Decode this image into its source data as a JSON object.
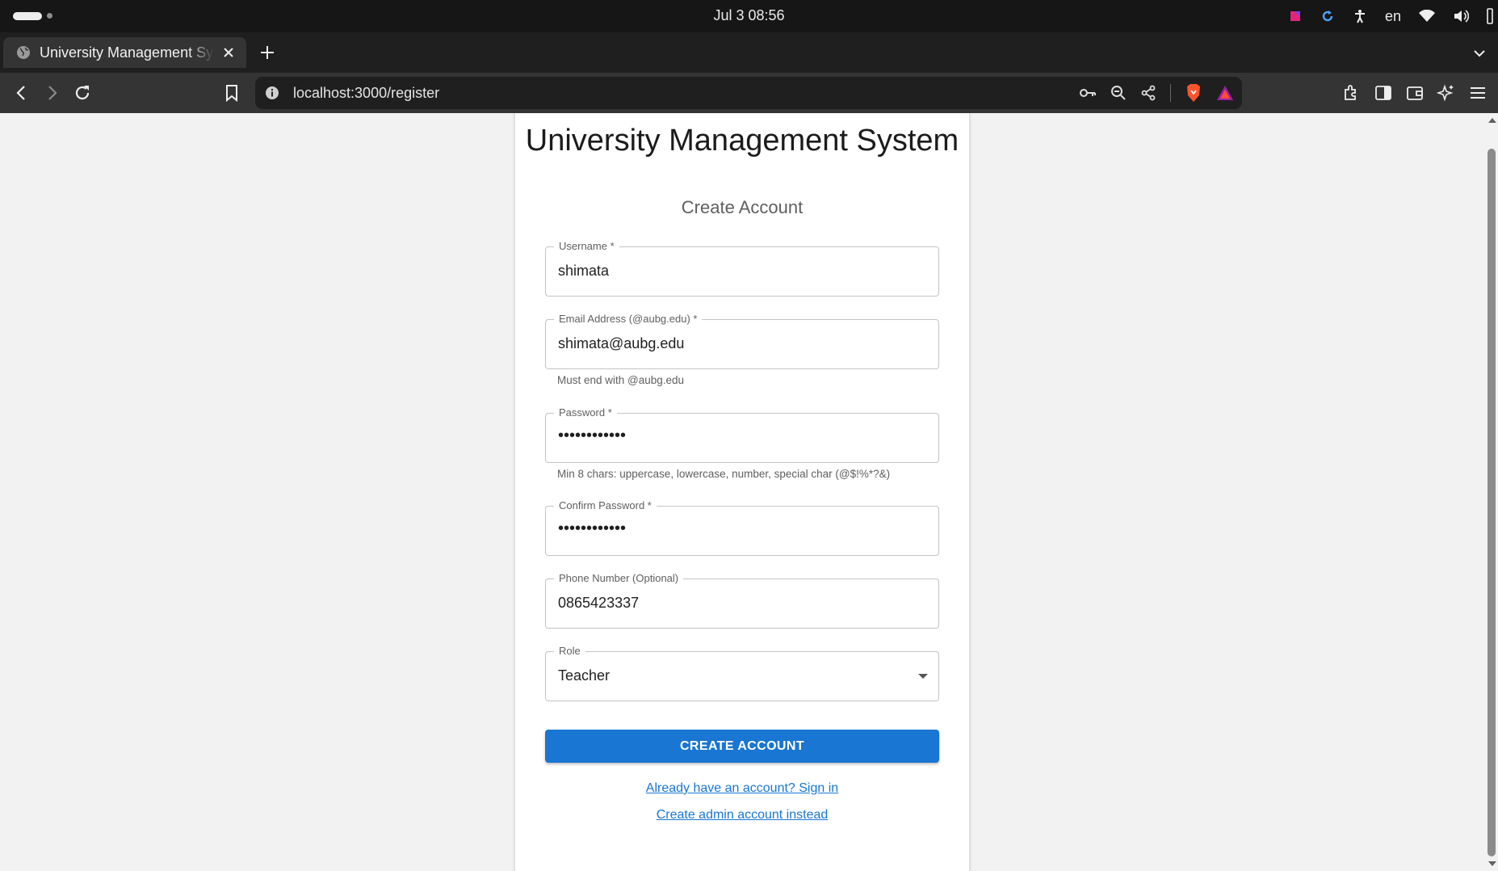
{
  "os": {
    "clock": "Jul 3  08:56",
    "language": "en"
  },
  "browser": {
    "tab_title": "University Management System",
    "url": "localhost:3000/register"
  },
  "page": {
    "title": "University Management System",
    "subtitle": "Create Account",
    "fields": {
      "username": {
        "label": "Username *",
        "value": "shimata"
      },
      "email": {
        "label": "Email Address (@aubg.edu) *",
        "value": "shimata@aubg.edu",
        "helper": "Must end with @aubg.edu"
      },
      "password": {
        "label": "Password *",
        "value": "••••••••••••",
        "helper": "Min 8 chars: uppercase, lowercase, number, special char (@$!%*?&)"
      },
      "confirm_password": {
        "label": "Confirm Password *",
        "value": "••••••••••••"
      },
      "phone": {
        "label": "Phone Number (Optional)",
        "value": "0865423337"
      },
      "role": {
        "label": "Role",
        "value": "Teacher"
      }
    },
    "submit_label": "CREATE ACCOUNT",
    "signin_link": "Already have an account? Sign in",
    "admin_link": "Create admin account instead"
  },
  "colors": {
    "primary": "#1976d2",
    "os_bar": "#161616",
    "toolbar": "#343434"
  }
}
